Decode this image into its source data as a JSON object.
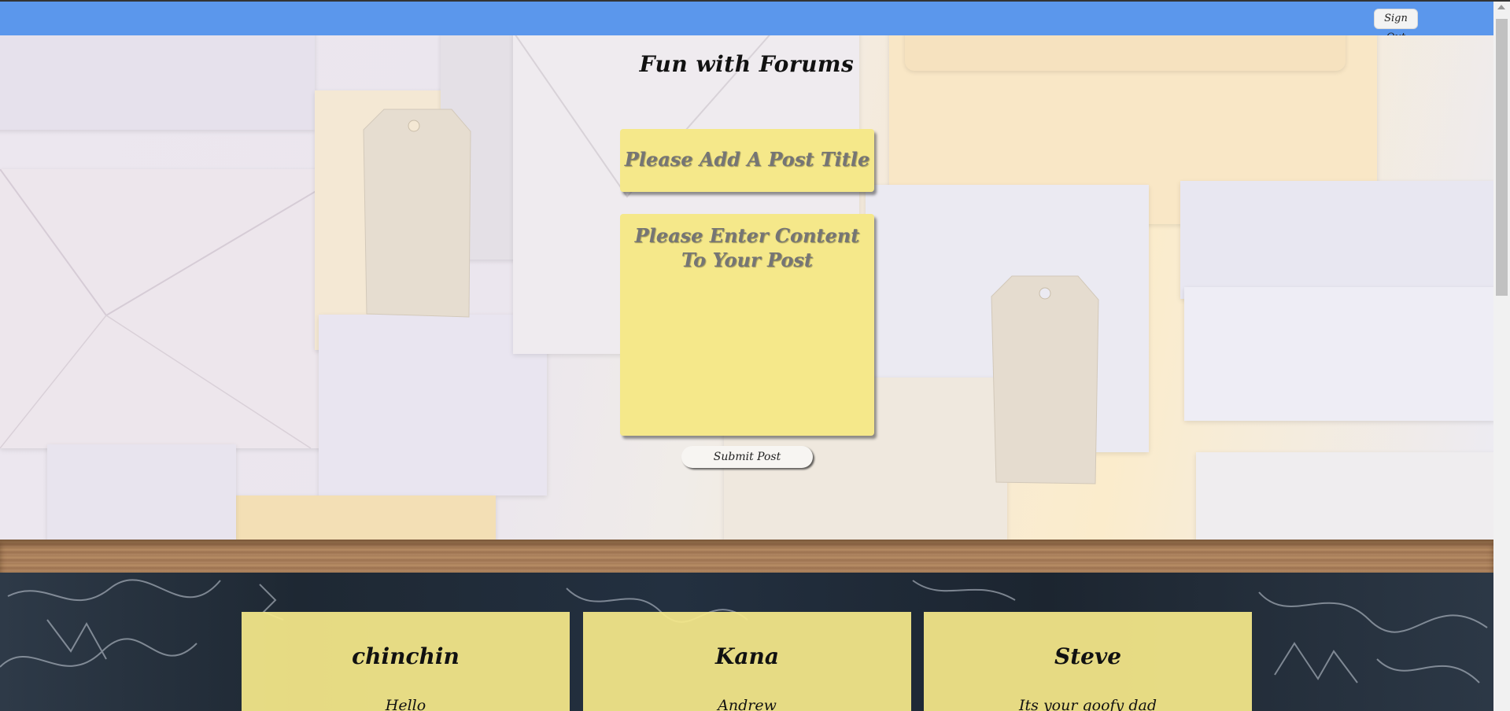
{
  "navbar": {
    "signout_label": "Sign Out"
  },
  "page": {
    "title": "Fun with Forums"
  },
  "post_form": {
    "title_placeholder": "Please Add A Post Title",
    "content_placeholder": "Please Enter Content To Your Post",
    "submit_label": "Submit Post"
  },
  "posts": [
    {
      "author": "chinchin",
      "body": "Hello"
    },
    {
      "author": "Kana",
      "body": "Andrew"
    },
    {
      "author": "Steve",
      "body": "Its your goofy dad"
    }
  ],
  "colors": {
    "navbar": "#5b97ec",
    "note_yellow": "#f5e88a",
    "chalkboard": "#1e2833",
    "wood": "#a57b55"
  }
}
